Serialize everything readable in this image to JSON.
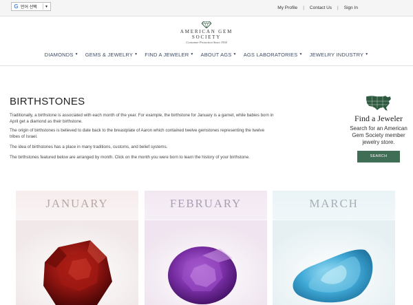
{
  "topbar": {
    "translate_label": "언어 선택",
    "links": [
      "My Profile",
      "Contact Us",
      "Sign In"
    ]
  },
  "logo": {
    "line1": "AMERICAN GEM",
    "line2": "SOCIETY",
    "tagline": "Consumer Protection Since 1934"
  },
  "nav": {
    "items": [
      "DIAMONDS",
      "GEMS & JEWELRY",
      "FIND A JEWELER",
      "ABOUT AGS",
      "AGS LABORATORIES",
      "JEWELRY INDUSTRY"
    ]
  },
  "main": {
    "title": "BIRTHSTONES",
    "paragraphs": [
      "Traditionally, a birthstone is associated with each month of the year. For example, the birthstone for January is a garnet, while babies born in April get a diamond as their birthstone.",
      "The origin of birthstones is believed to date back to the breastplate of Aaron which contained twelve gemstones representing the twelve tribes of Israel.",
      "The idea of birthstones has a place in many traditions, customs, and belief systems.",
      "The birthstones featured below are arranged by month. Click on the month you were born to learn the history of your birthstone."
    ]
  },
  "finder": {
    "title": "Find a Jeweler",
    "description": "Search for an American Gem Society member jewelry store.",
    "button": "SEARCH",
    "button_color": "#3f6d56"
  },
  "months": [
    {
      "name": "JANUARY",
      "gem_color": "#8e1410"
    },
    {
      "name": "FEBRUARY",
      "gem_color": "#7a2fa6"
    },
    {
      "name": "MARCH",
      "gem_color": "#3fa8d6"
    }
  ],
  "colors": {
    "nav_text": "#3d4c66",
    "map_green": "#2e5a3f"
  }
}
